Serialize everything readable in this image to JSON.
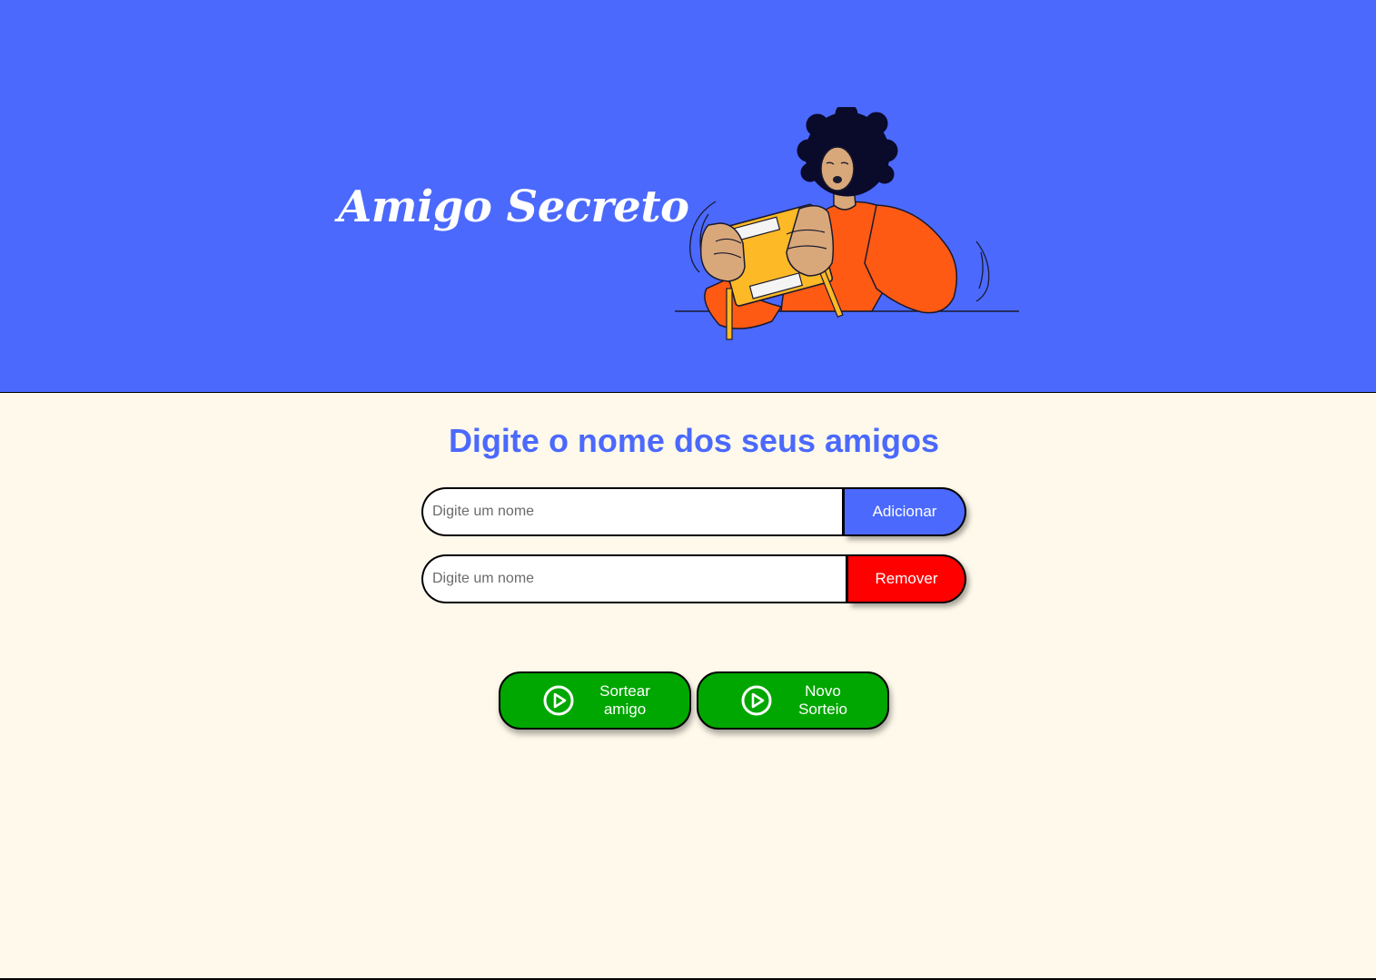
{
  "colors": {
    "header_bg": "#4B69FD",
    "page_bg": "#FFF9EB",
    "primary": "#4B69FD",
    "danger": "#FF0000",
    "success": "#00A700",
    "white": "#FFFFFF"
  },
  "header": {
    "title": "Amigo Secreto",
    "illustration": "person-holding-gift-box-illustration"
  },
  "main": {
    "title": "Digite o nome dos seus amigos",
    "add_row": {
      "placeholder": "Digite um nome",
      "value": "",
      "button_label": "Adicionar"
    },
    "remove_row": {
      "placeholder": "Digite um nome",
      "value": "",
      "button_label": "Remover"
    },
    "actions": {
      "draw": {
        "line1": "Sortear",
        "line2": "amigo",
        "icon": "play-circle-icon"
      },
      "new_draw": {
        "line1": "Novo",
        "line2": "Sorteio",
        "icon": "play-circle-icon"
      }
    }
  }
}
